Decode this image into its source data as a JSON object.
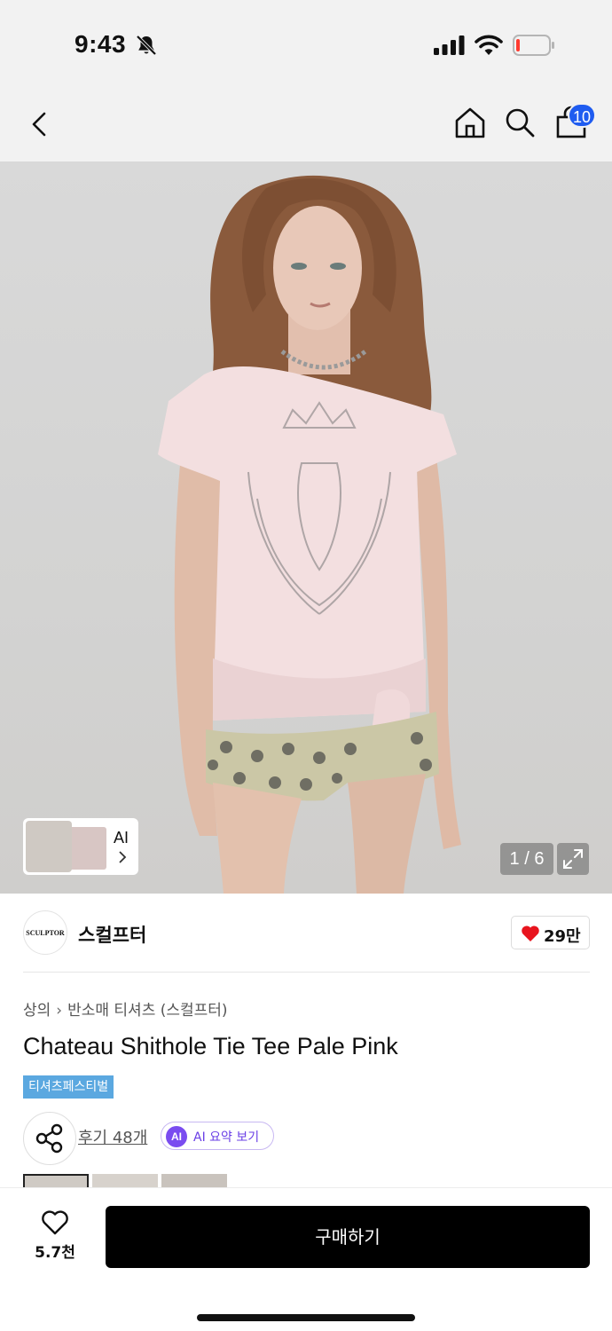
{
  "status_bar": {
    "time": "9:43",
    "icons": [
      "bell-slash-icon",
      "cellular-signal-icon",
      "wifi-icon",
      "battery-low-icon"
    ],
    "battery_color": "#ff3b30"
  },
  "header": {
    "icons": [
      "chevron-left-icon",
      "home-icon",
      "search-icon",
      "shopping-bag-icon"
    ],
    "cart_badge": "10",
    "badge_color": "#1f5cf0"
  },
  "hero": {
    "ai_label": "AI",
    "counter": "1 / 6"
  },
  "brand": {
    "logo_text": "SCULPTOR",
    "name": "스컬프터",
    "like_count": "29만",
    "heart_color": "#e8141e"
  },
  "product": {
    "breadcrumb": [
      "상의",
      "반소매 티셔츠 (스컬프터)"
    ],
    "title": "Chateau Shithole Tie Tee Pale Pink",
    "tag": "티셔츠페스티벌",
    "tag_color": "#5ba8e0",
    "review_link": "후기 48개",
    "ai_badge": "AI",
    "ai_summary": "AI 요약 보기",
    "ai_color": "#7a4cf0"
  },
  "bottom_bar": {
    "wish_count": "5.7천",
    "buy_label": "구매하기"
  }
}
